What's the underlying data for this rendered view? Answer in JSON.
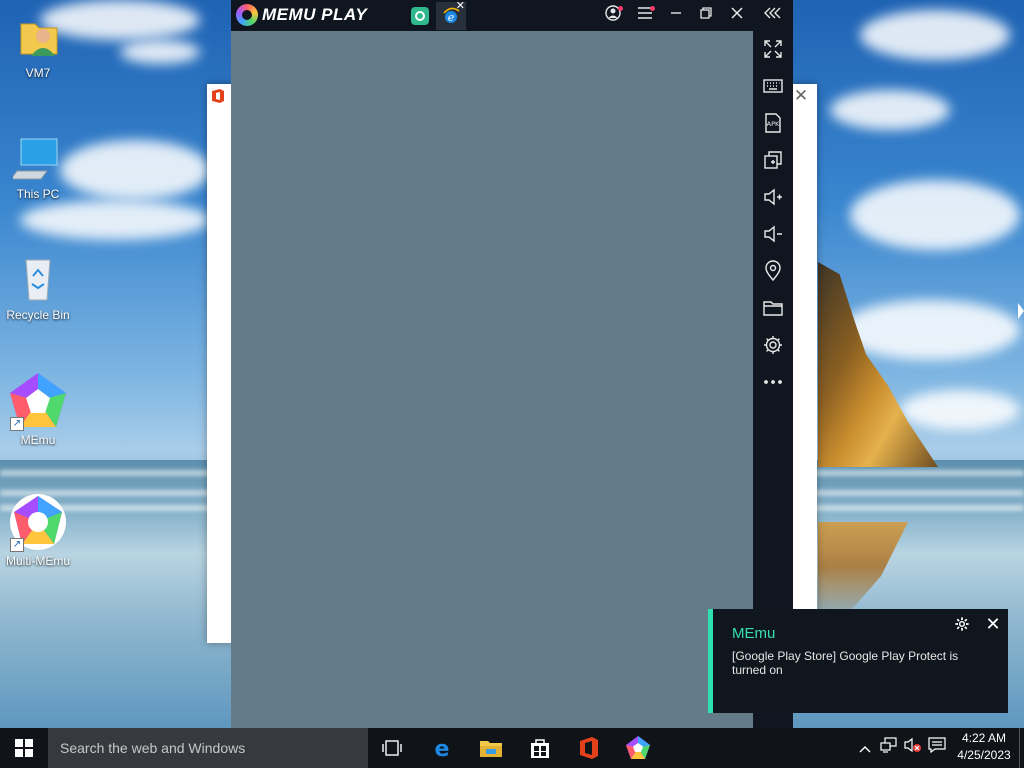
{
  "desktop": {
    "icons": [
      {
        "label": "VM7"
      },
      {
        "label": "This PC"
      },
      {
        "label": "Recycle Bin"
      },
      {
        "label": "MEmu"
      },
      {
        "label": "Multi-MEmu"
      }
    ]
  },
  "memu": {
    "brand": "MEMU PLAY",
    "tabs": [
      {
        "icon": "app-tab-icon",
        "color": "#2fb98c"
      },
      {
        "icon": "internet-explorer-icon",
        "color": "#1e88e5",
        "active": true
      }
    ],
    "title_buttons": [
      "account-icon",
      "menu-icon",
      "minimize-icon",
      "restore-icon",
      "close-icon",
      "collapse-icon"
    ],
    "sidebar": [
      "fullscreen-icon",
      "keyboard-icon",
      "apk-icon",
      "multi-window-icon",
      "volume-up-icon",
      "volume-down-icon",
      "location-icon",
      "folder-icon",
      "settings-icon",
      "more-icon"
    ],
    "apk_label": "APK",
    "screen_color": "#647b8a"
  },
  "toast": {
    "app": "MEmu",
    "message": "[Google Play Store] Google Play Protect is turned on",
    "accent": "#2ee0b0"
  },
  "taskbar": {
    "search_placeholder": "Search the web and Windows",
    "time": "4:22 AM",
    "date": "4/25/2023"
  }
}
